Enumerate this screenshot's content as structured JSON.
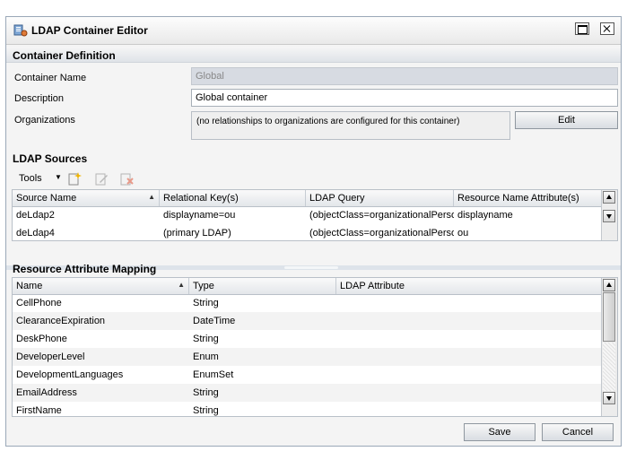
{
  "window": {
    "title": "LDAP Container Editor"
  },
  "container_definition": {
    "header": "Container Definition",
    "name_label": "Container Name",
    "name_value": "Global",
    "description_label": "Description",
    "description_value": "Global container",
    "organizations_label": "Organizations",
    "organizations_text": "(no relationships to organizations are configured for this container)",
    "edit_label": "Edit"
  },
  "ldap_sources": {
    "header": "LDAP Sources",
    "tools_label": "Tools",
    "columns": [
      "Source Name",
      "Relational Key(s)",
      "LDAP Query",
      "Resource Name Attribute(s)"
    ],
    "rows": [
      [
        "deLdap2",
        "displayname=ou",
        "(objectClass=organizationalPersor",
        "displayname"
      ],
      [
        "deLdap4",
        "(primary LDAP)",
        "(objectClass=organizationalPersor",
        "ou"
      ]
    ]
  },
  "resource_attribute_mapping": {
    "header": "Resource Attribute Mapping",
    "columns": [
      "Name",
      "Type",
      "LDAP Attribute"
    ],
    "rows": [
      [
        "CellPhone",
        "String",
        ""
      ],
      [
        "ClearanceExpiration",
        "DateTime",
        ""
      ],
      [
        "DeskPhone",
        "String",
        ""
      ],
      [
        "DeveloperLevel",
        "Enum",
        ""
      ],
      [
        "DevelopmentLanguages",
        "EnumSet",
        ""
      ],
      [
        "EmailAddress",
        "String",
        ""
      ],
      [
        "FirstName",
        "String",
        ""
      ]
    ]
  },
  "footer": {
    "save_label": "Save",
    "cancel_label": "Cancel"
  },
  "icons": {
    "title": "ldap-container-icon",
    "add": "add-source-icon",
    "edit": "edit-source-icon",
    "delete": "delete-source-icon"
  },
  "colors": {
    "section_header": "#dfe3e8",
    "disabled_field": "#d7dbe2",
    "alt_row": "#f3f3f3"
  }
}
